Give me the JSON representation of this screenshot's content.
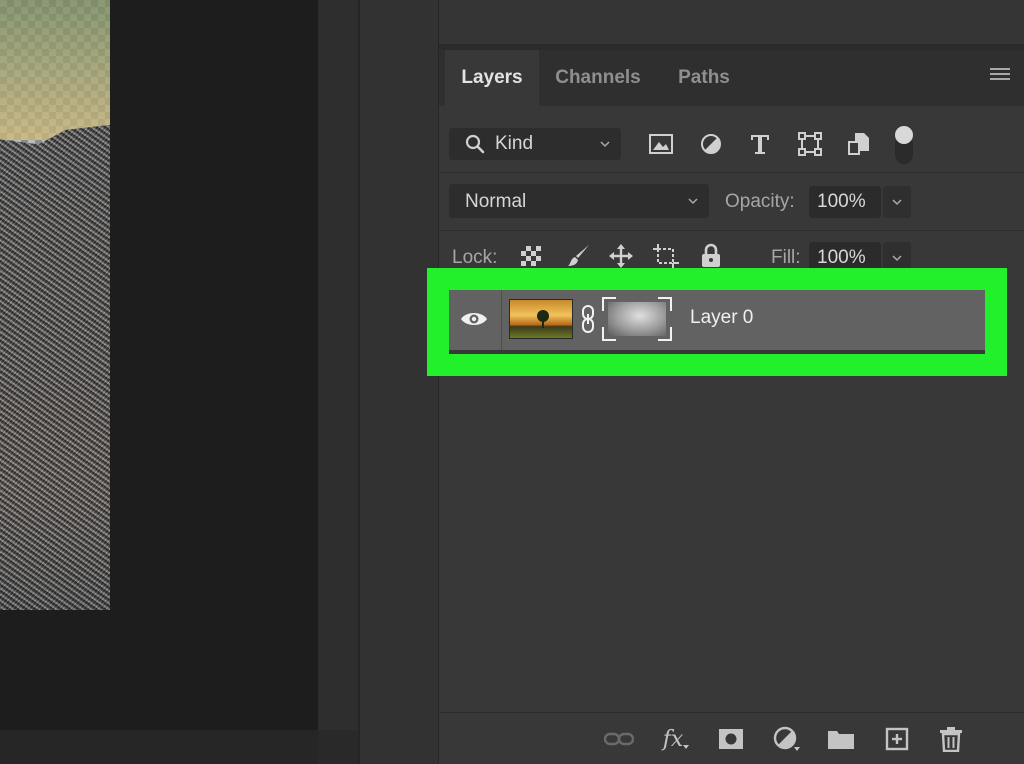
{
  "tabs": [
    {
      "label": "Layers",
      "active": true
    },
    {
      "label": "Channels",
      "active": false
    },
    {
      "label": "Paths",
      "active": false
    }
  ],
  "filter": {
    "kind_label": "Kind",
    "icons": [
      "pixel-layer-filter-icon",
      "adjustment-layer-filter-icon",
      "type-layer-filter-icon",
      "shape-layer-filter-icon",
      "smart-object-filter-icon"
    ]
  },
  "blend": {
    "mode": "Normal",
    "opacity_label": "Opacity:",
    "opacity_value": "100%"
  },
  "lock": {
    "label": "Lock:",
    "fill_label": "Fill:",
    "fill_value": "100%",
    "icons": [
      "lock-transparent-pixels-icon",
      "lock-image-pixels-icon",
      "lock-position-icon",
      "lock-artboard-icon",
      "lock-all-icon"
    ]
  },
  "layers": [
    {
      "name": "Layer 0",
      "visible": true,
      "has_mask": true,
      "selected": true
    }
  ],
  "bottom_toolbar": {
    "icons": [
      "link-layers-icon",
      "layer-style-fx-icon",
      "add-mask-icon",
      "new-adjustment-layer-icon",
      "new-group-icon",
      "new-layer-icon",
      "delete-layer-icon"
    ],
    "fx_label": "fx"
  },
  "colors": {
    "highlight": "#22f02a",
    "panel_bg": "#383838",
    "selected_row": "#626262"
  }
}
